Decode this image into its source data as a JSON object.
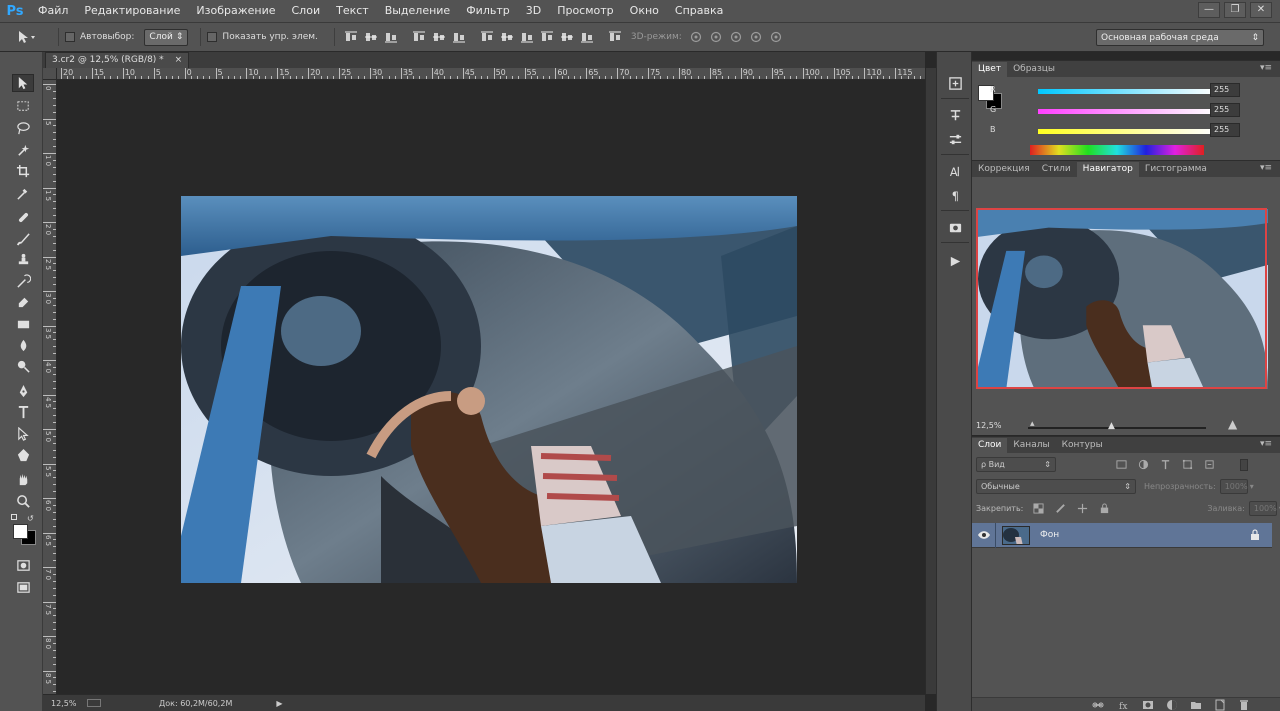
{
  "app": {
    "logo": "Ps"
  },
  "menu": [
    "Файл",
    "Редактирование",
    "Изображение",
    "Слои",
    "Текст",
    "Выделение",
    "Фильтр",
    "3D",
    "Просмотр",
    "Окно",
    "Справка"
  ],
  "window_controls": {
    "minimize": "—",
    "restore": "❐",
    "close": "✕"
  },
  "options": {
    "autoselect_label": "Автовыбор:",
    "autoselect_value": "Слой",
    "show_transform_label": "Показать упр. элем.",
    "mode_3d_label": "3D-режим:",
    "workspace": "Основная рабочая среда"
  },
  "document": {
    "tab_title": "3.cr2 @ 12,5% (RGB/8) *",
    "tab_close": "×",
    "ruler_top": [
      "20",
      "15",
      "10",
      "5",
      "0",
      "5",
      "10",
      "15",
      "20",
      "25",
      "30",
      "35",
      "40",
      "45",
      "50",
      "55",
      "60",
      "65",
      "70",
      "75",
      "80",
      "85",
      "90",
      "95",
      "100",
      "105",
      "110",
      "115"
    ],
    "ruler_left": [
      "0",
      "5",
      "1 0",
      "1 5",
      "2 0",
      "2 5",
      "3 0",
      "3 5",
      "4 0",
      "4 5",
      "5 0",
      "5 5",
      "6 0",
      "6 5",
      "7 0",
      "7 5",
      "8 0",
      "8 5"
    ],
    "status_zoom": "12,5%",
    "status_doc": "Док: 60,2M/60,2M",
    "status_arrow": "▶"
  },
  "color_panel": {
    "tabs": [
      "Цвет",
      "Образцы"
    ],
    "active_tab": 0,
    "menu": "▾≡",
    "channels": [
      {
        "label": "R",
        "value": "255",
        "gradient": [
          "#00c8ff",
          "#ffffff"
        ]
      },
      {
        "label": "G",
        "value": "255",
        "gradient": [
          "#ff40ff",
          "#ffffff"
        ]
      },
      {
        "label": "B",
        "value": "255",
        "gradient": [
          "#ffff20",
          "#ffffff"
        ]
      }
    ],
    "foreground": "#ffffff",
    "background": "#000000"
  },
  "navigator_panel": {
    "tabs": [
      "Коррекция",
      "Стили",
      "Навигатор",
      "Гистограмма"
    ],
    "active_tab": 2,
    "menu": "▾≡",
    "zoom": "12,5%"
  },
  "layers_panel": {
    "tabs": [
      "Слои",
      "Каналы",
      "Контуры"
    ],
    "active_tab": 0,
    "menu": "▾≡",
    "filter_kind": "ρ Вид",
    "blend_mode": "Обычные",
    "opacity_label": "Непрозрачность:",
    "opacity_value": "100%",
    "lock_label": "Закрепить:",
    "fill_label": "Заливка:",
    "fill_value": "100%",
    "layers": [
      {
        "name": "Фон",
        "visible": true,
        "locked": true
      }
    ]
  },
  "colors": {
    "menubar": "#535353",
    "canvas_bg": "#282828",
    "selected_layer": "#607597",
    "nav_frame": "#dd4444"
  }
}
